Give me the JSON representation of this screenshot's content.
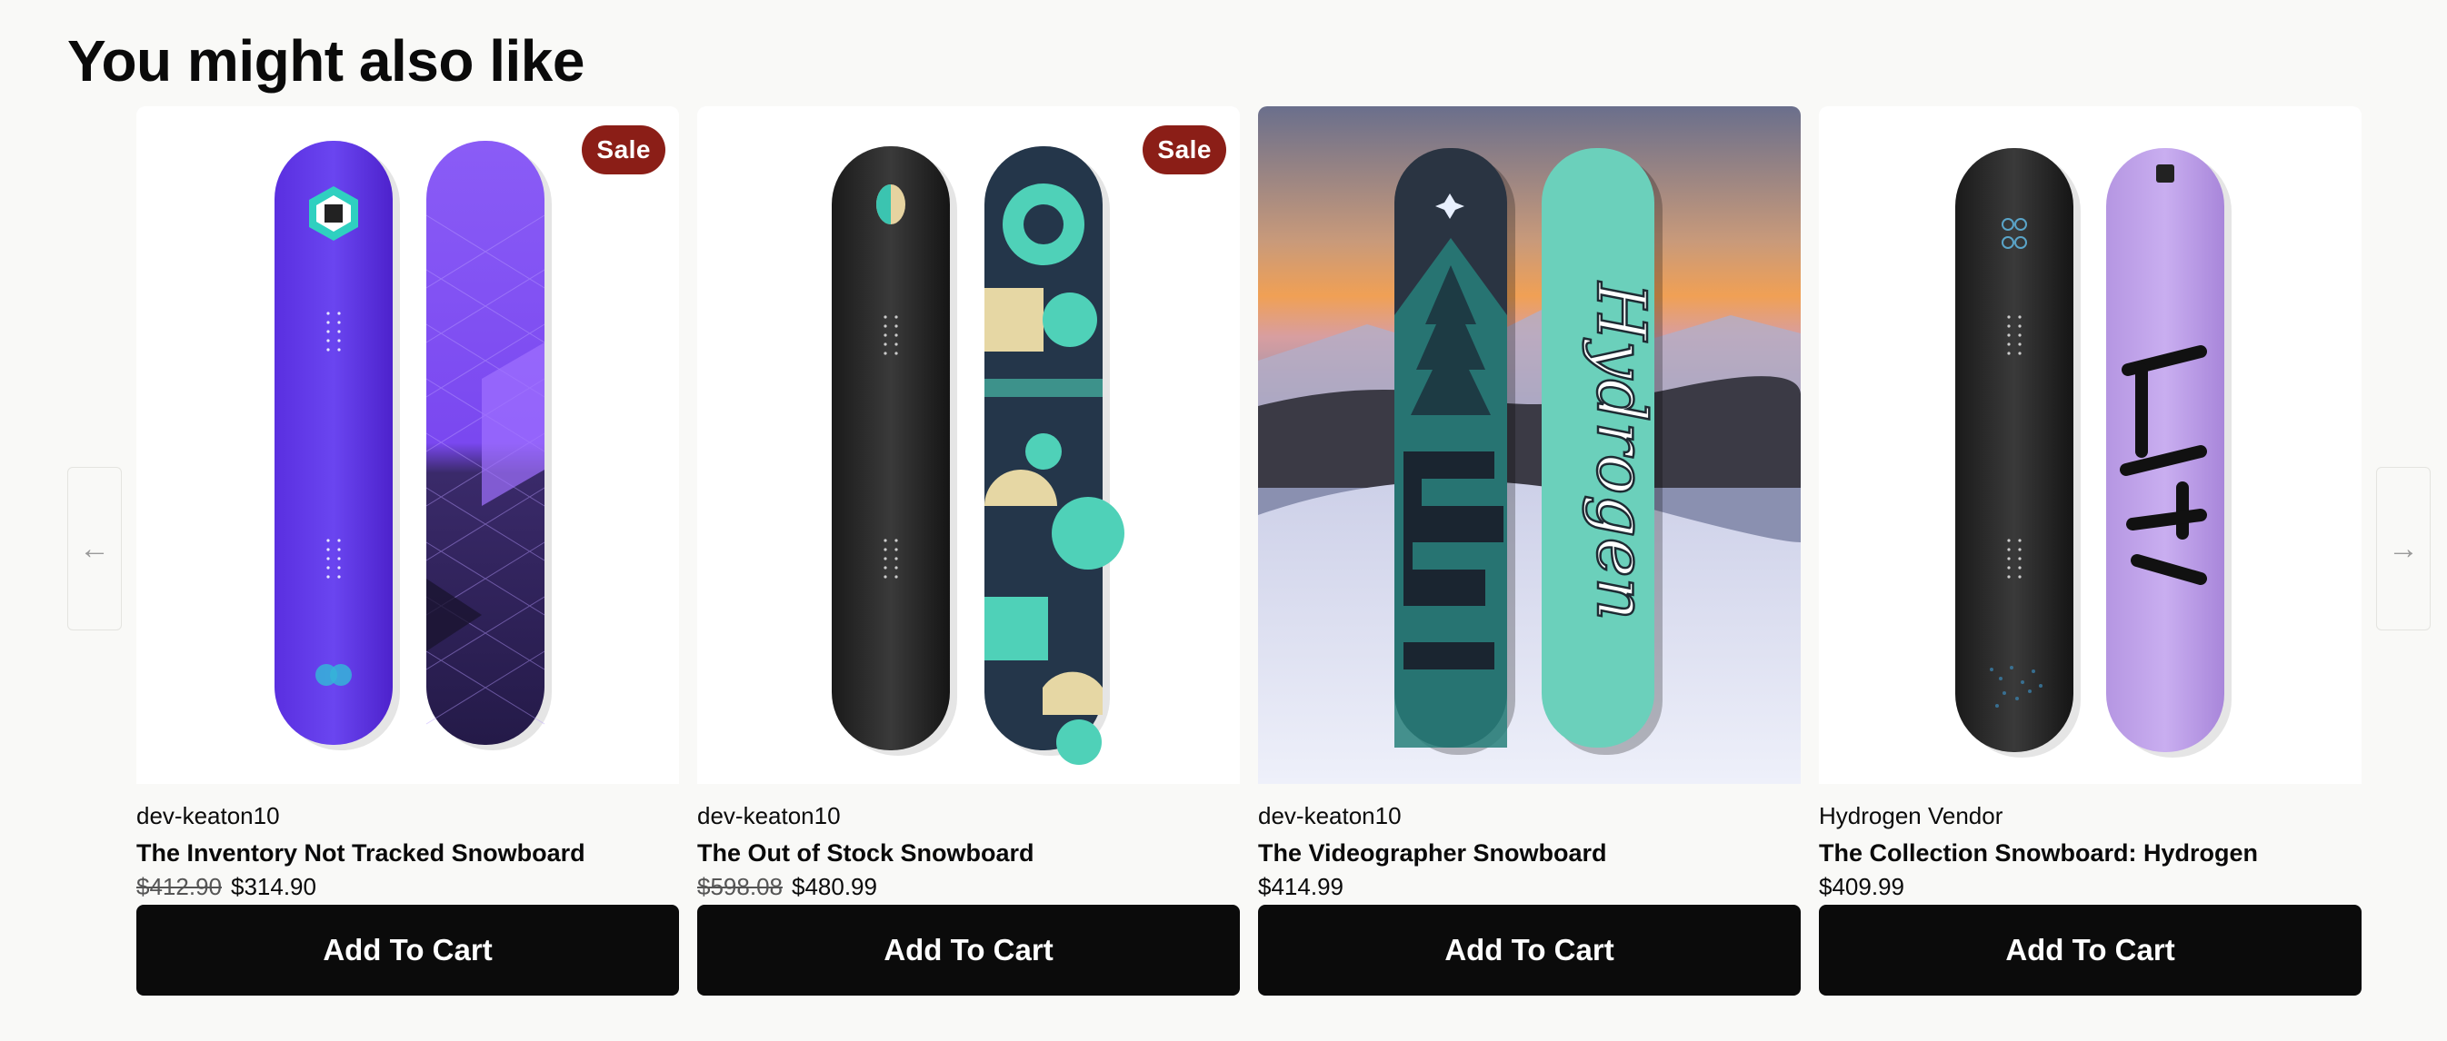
{
  "section": {
    "heading": "You might also like"
  },
  "nav": {
    "prev_glyph": "←",
    "next_glyph": "→"
  },
  "products": [
    {
      "vendor": "dev-keaton10",
      "title": "The Inventory Not Tracked Snowboard",
      "compare_price": "$412.90",
      "price": "$314.90",
      "badge": "Sale",
      "button": "Add To Cart",
      "image": "purple-snowboard-pair"
    },
    {
      "vendor": "dev-keaton10",
      "title": "The Out of Stock Snowboard",
      "compare_price": "$598.08",
      "price": "$480.99",
      "badge": "Sale",
      "button": "Add To Cart",
      "image": "black-teal-snowboard-pair"
    },
    {
      "vendor": "dev-keaton10",
      "title": "The Videographer Snowboard",
      "compare_price": "",
      "price": "$414.99",
      "badge": "",
      "button": "Add To Cart",
      "image": "hydrogen-snow-scene"
    },
    {
      "vendor": "Hydrogen Vendor",
      "title": "The Collection Snowboard: Hydrogen",
      "compare_price": "",
      "price": "$409.99",
      "badge": "",
      "button": "Add To Cart",
      "image": "black-lilac-snowboard-pair"
    }
  ],
  "colors": {
    "sale_badge": "#8b1e17",
    "button_bg": "#0b0b0b",
    "page_bg": "#f9f9f7"
  }
}
